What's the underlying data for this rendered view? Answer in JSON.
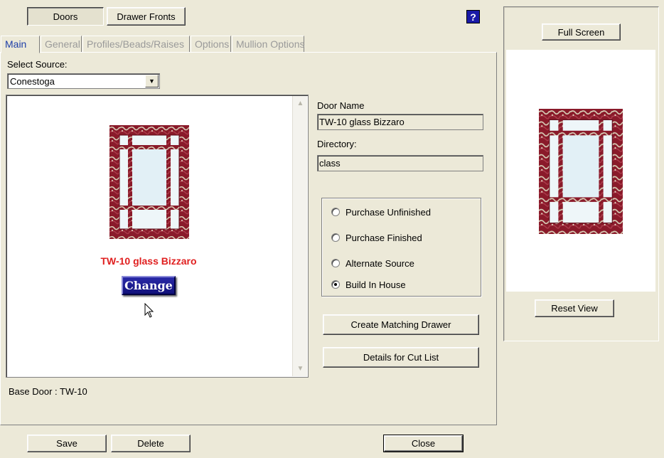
{
  "top_tabs": [
    {
      "label": "Doors",
      "pressed": true
    },
    {
      "label": "Drawer Fronts",
      "pressed": false
    }
  ],
  "help_label": "?",
  "tabs": [
    {
      "label": "Main",
      "active": true
    },
    {
      "label": "General",
      "active": false
    },
    {
      "label": "Profiles/Beads/Raises",
      "active": false
    },
    {
      "label": "Options",
      "active": false
    },
    {
      "label": "Mullion Options",
      "active": false
    }
  ],
  "source": {
    "label": "Select Source:",
    "value": "Conestoga"
  },
  "preview": {
    "door_name": "TW-10 glass Bizzaro",
    "change_label": "Change",
    "name_color": "#e02020"
  },
  "door_name": {
    "label": "Door Name",
    "value": "TW-10 glass Bizzaro"
  },
  "directory": {
    "label": "Directory:",
    "value": "class"
  },
  "options": [
    {
      "label": "Purchase Unfinished",
      "checked": false
    },
    {
      "label": "Purchase Finished",
      "checked": false
    },
    {
      "label": "Alternate Source",
      "checked": false
    },
    {
      "label": "Build In House",
      "checked": true
    }
  ],
  "actions": {
    "create_matching_drawer": "Create Matching Drawer",
    "details_for_cut_list": "Details for Cut List"
  },
  "base_door": "Base Door : TW-10",
  "right": {
    "full_screen": "Full Screen",
    "reset_view": "Reset View"
  },
  "footer": {
    "save": "Save",
    "delete": "Delete",
    "close": "Close"
  },
  "colors": {
    "frame": "#8a1a2a",
    "glass": "#e8f4f8",
    "accent": "#1a1aa8"
  }
}
